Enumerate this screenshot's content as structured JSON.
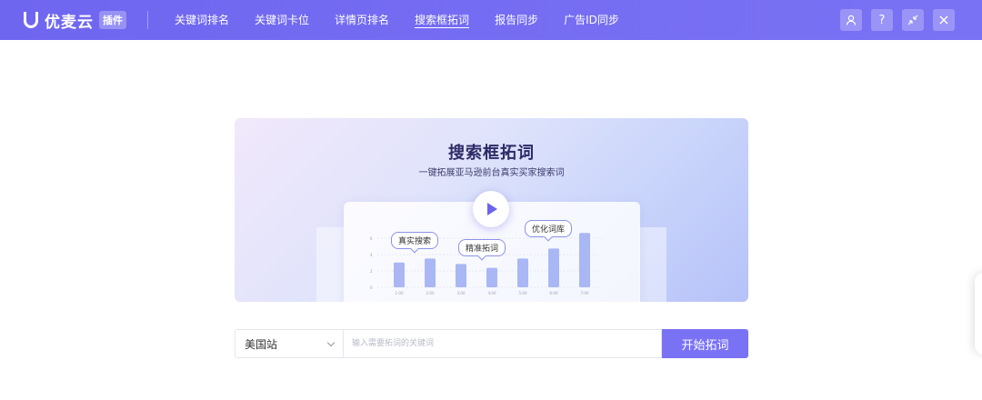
{
  "app": {
    "name": "优麦云",
    "tag": "插件"
  },
  "nav": [
    {
      "label": "关键词排名",
      "active": false
    },
    {
      "label": "关键词卡位",
      "active": false
    },
    {
      "label": "详情页排名",
      "active": false
    },
    {
      "label": "搜索框拓词",
      "active": true
    },
    {
      "label": "报告同步",
      "active": false
    },
    {
      "label": "广告ID同步",
      "active": false
    }
  ],
  "toolbar": {
    "icons": [
      "user-icon",
      "help-icon",
      "shrink-icon",
      "close-icon"
    ],
    "help_glyph": "?"
  },
  "banner": {
    "title": "搜索框拓词",
    "subtitle": "一键拓展亚马逊前台真实买家搜索词",
    "bubbles": [
      "真实搜索",
      "精准拓词",
      "优化词库"
    ],
    "chart": {
      "y_ticks": [
        "6",
        "4",
        "2",
        "0"
      ],
      "x_labels": [
        "1:00",
        "2:00",
        "3:00",
        "4:00",
        "5:00",
        "6:00",
        "7:00"
      ],
      "values": [
        3.2,
        3.7,
        3.0,
        2.5,
        3.7,
        5.0,
        7.0
      ],
      "bar_color": "#a9b7f5"
    }
  },
  "search": {
    "site": "美国站",
    "placeholder": "输入需要拓词的关键词",
    "value": "",
    "button_label": "开始拓词"
  },
  "colors": {
    "accent": "#7a72f4",
    "header": "#6f66f0"
  }
}
